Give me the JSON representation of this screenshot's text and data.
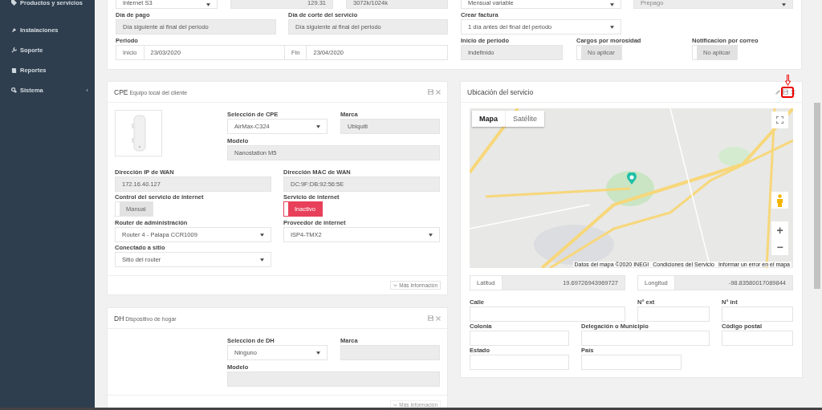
{
  "sidebar": {
    "items": [
      {
        "label": "Productos y servicios"
      },
      {
        "label": "Instalaciones"
      },
      {
        "label": "Soporte"
      },
      {
        "label": "Reportes"
      },
      {
        "label": "Sistema",
        "caret": "‹"
      }
    ]
  },
  "billing": {
    "plan": {
      "value": "Internet S3"
    },
    "price": {
      "value": "129.31"
    },
    "speed": {
      "value": "3072k/1024k"
    },
    "cycle": {
      "value": "Mensual variable"
    },
    "payment": {
      "value": "Prepago",
      "disabled": true
    },
    "payment_day": {
      "label": "Día de pago",
      "value": "Día siguiente al final del periodo"
    },
    "cutoff_day": {
      "label": "Día de corte del servicio",
      "value": "Día siguiente al final del periodo"
    },
    "invoice": {
      "label": "Crear factura",
      "value": "1 día antes del final del periodo"
    },
    "period": {
      "label": "Periodo",
      "start_addon": "Inicio",
      "start": "23/03/2020",
      "end_addon": "Fin",
      "end": "23/04/2020"
    },
    "period_start": {
      "label": "Inicio de periodo",
      "value": "Indefinido"
    },
    "late_fees": {
      "label": "Cargos por morosidad",
      "toggle": {
        "label": "No aplicar",
        "on": false,
        "kind": "plain"
      }
    },
    "email_notice": {
      "label": "Notificacion por correo",
      "toggle": {
        "label": "No aplicar",
        "on": false,
        "kind": "plain"
      }
    }
  },
  "cpe": {
    "title": "CPE",
    "subtitle": "Equipo local del cliente",
    "select": {
      "label": "Selección de CPE",
      "value": "AirMax-C324"
    },
    "brand": {
      "label": "Marca",
      "value": "Ubiquiti"
    },
    "model": {
      "label": "Modelo",
      "value": "Nanostation M5"
    },
    "wan_ip": {
      "label": "Dirección IP de WAN",
      "value": "172.16.40.127"
    },
    "wan_mac": {
      "label": "Dirección MAC de WAN",
      "value": "DC:9F:DB:92:56:5E"
    },
    "control": {
      "label": "Control del servicio de internet",
      "toggle": {
        "label": "Manual",
        "on": false,
        "kind": "plain"
      }
    },
    "service": {
      "label": "Servicio de internet",
      "toggle": {
        "label": "Inactivo",
        "on": false,
        "kind": "danger"
      }
    },
    "router": {
      "label": "Router de administración",
      "value": "Router 4 - Palapa CCR1009"
    },
    "provider": {
      "label": "Proveedor de internet",
      "value": "ISP4-TMX2"
    },
    "site": {
      "label": "Conectado a sitio",
      "value": "Sitio del router"
    },
    "more": {
      "label": "Más información",
      "disabled": false
    }
  },
  "dh": {
    "title": "DH",
    "subtitle": "Dispositivo de hogar",
    "select": {
      "label": "Selección de DH",
      "value": "Ninguno"
    },
    "brand": {
      "label": "Marca"
    },
    "model": {
      "label": "Modelo"
    },
    "more": {
      "label": "Más información",
      "disabled": true
    }
  },
  "location": {
    "title": "Ubicación del servicio",
    "map": {
      "tabs": [
        {
          "label": "Mapa",
          "selected": true
        },
        {
          "label": "Satélite",
          "selected": false
        }
      ],
      "zoom_in": "+",
      "zoom_out": "−",
      "attribution": [
        "Datos del mapa ©2020 INEGI",
        "Condiciones del Servicio",
        "Informar un error en el mapa"
      ]
    },
    "latitude": {
      "addon": "Latitud",
      "value": "19.69726943969727"
    },
    "longitude": {
      "addon": "Longitud",
      "value": "-98.83580017089844"
    },
    "address": [
      {
        "label": "Calle"
      },
      {
        "label": "N° ext"
      },
      {
        "label": "N° int"
      },
      {
        "label": "Colonia"
      },
      {
        "label": "Delegación o Municipio"
      },
      {
        "label": "Código postal"
      },
      {
        "label": "Estado"
      },
      {
        "label": "País"
      }
    ]
  }
}
